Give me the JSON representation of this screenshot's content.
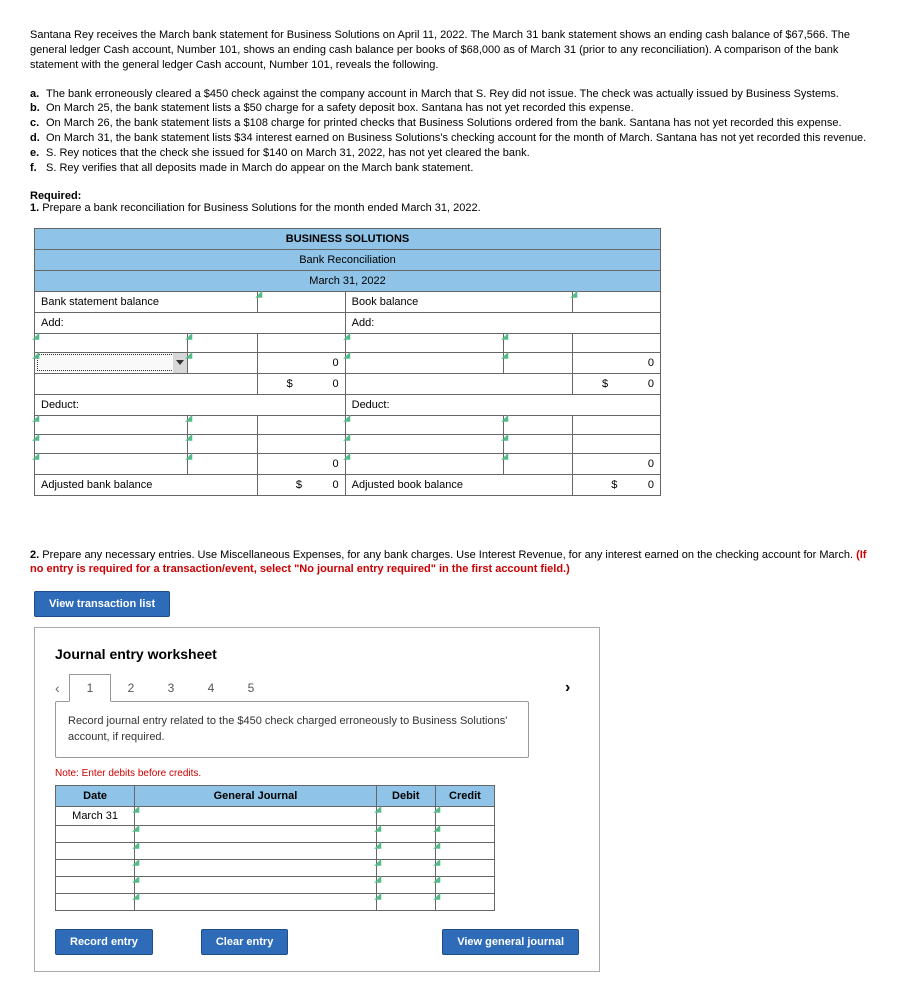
{
  "intro": "Santana Rey receives the March bank statement for Business Solutions on April 11, 2022. The March 31 bank statement shows an ending cash balance of $67,566. The general ledger Cash account, Number 101, shows an ending cash balance per books of $68,000 as of March 31 (prior to any reconciliation). A comparison of the bank statement with the general ledger Cash account, Number 101, reveals the following.",
  "items": [
    {
      "label": "a.",
      "text": "The bank erroneously cleared a $450 check against the company account in March that S. Rey did not issue. The check was actually issued by Business Systems."
    },
    {
      "label": "b.",
      "text": "On March 25, the bank statement lists a $50 charge for a safety deposit box. Santana has not yet recorded this expense."
    },
    {
      "label": "c.",
      "text": "On March 26, the bank statement lists a $108 charge for printed checks that Business Solutions ordered from the bank. Santana has not yet recorded this expense."
    },
    {
      "label": "d.",
      "text": "On March 31, the bank statement lists $34 interest earned on Business Solutions's checking account for the month of March. Santana has not yet recorded this revenue."
    },
    {
      "label": "e.",
      "text": "S. Rey notices that the check she issued for $140 on March 31, 2022, has not yet cleared the bank."
    },
    {
      "label": "f.",
      "text": "S. Rey verifies that all deposits made in March do appear on the March bank statement."
    }
  ],
  "required_label": "Required:",
  "req1_num": "1.",
  "req1_text": "Prepare a bank reconciliation for Business Solutions for the month ended March 31, 2022.",
  "recon": {
    "company": "BUSINESS SOLUTIONS",
    "title": "Bank Reconciliation",
    "date": "March 31, 2022",
    "bank_label": "Bank statement balance",
    "book_label": "Book balance",
    "add_label": "Add:",
    "deduct_label": "Deduct:",
    "adj_bank_label": "Adjusted bank balance",
    "adj_book_label": "Adjusted book balance",
    "zero": "0",
    "dollar": "$"
  },
  "req2_num": "2.",
  "req2_text": "Prepare any necessary entries. Use Miscellaneous Expenses, for any bank charges. Use Interest Revenue, for any interest earned on the checking account for March. ",
  "req2_red": "(If no entry is required for a transaction/event, select \"No journal entry required\" in the first account field.)",
  "btn_view_txn": "View transaction list",
  "journal": {
    "heading": "Journal entry worksheet",
    "tabs": [
      "1",
      "2",
      "3",
      "4",
      "5"
    ],
    "desc": "Record journal entry related to the $450 check charged erroneously to Business Solutions' account, if required.",
    "note": "Note: Enter debits before credits.",
    "headers": {
      "date": "Date",
      "gj": "General Journal",
      "debit": "Debit",
      "credit": "Credit"
    },
    "row_date": "March 31",
    "btn_record": "Record entry",
    "btn_clear": "Clear entry",
    "btn_view_gj": "View general journal"
  }
}
